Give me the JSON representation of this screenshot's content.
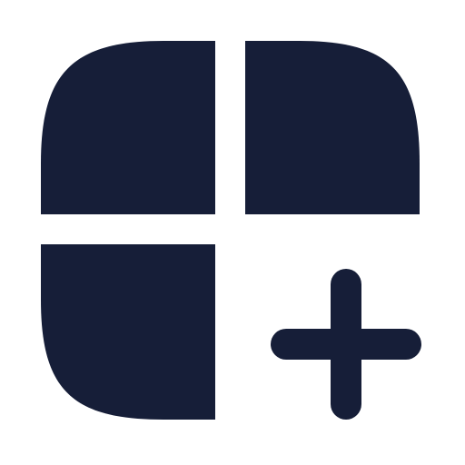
{
  "icon": {
    "name": "widget-add-icon",
    "color": "#161e38",
    "background": "#ffffff"
  }
}
